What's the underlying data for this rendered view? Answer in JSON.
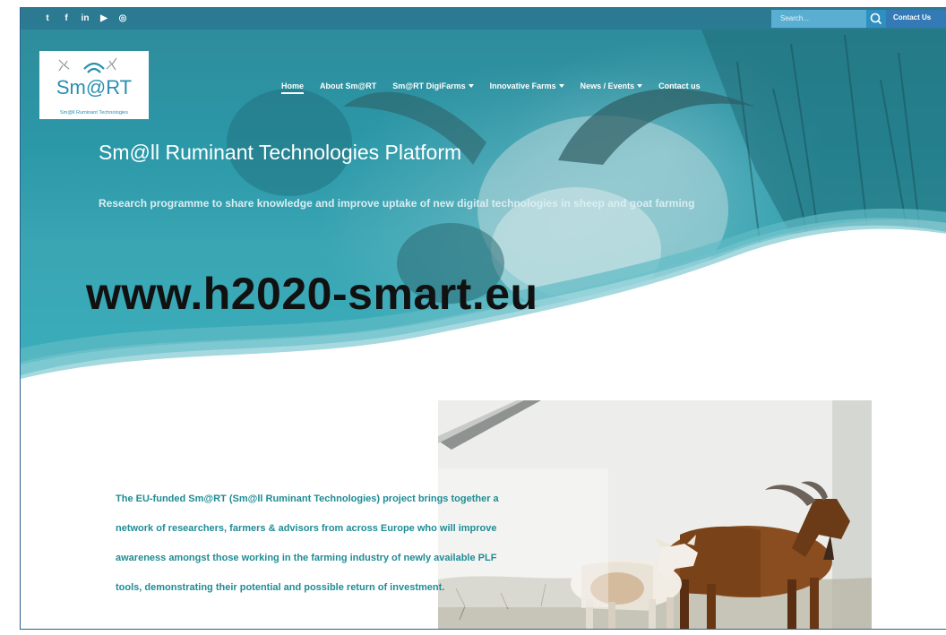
{
  "topbar": {
    "social_icons": [
      "twitter-icon",
      "facebook-icon",
      "linkedin-icon",
      "youtube-icon",
      "instagram-icon"
    ],
    "social_glyphs": [
      "t",
      "f",
      "in",
      "▶",
      "◎"
    ],
    "search": {
      "placeholder": "Search..."
    },
    "contact_label": "Contact Us"
  },
  "logo": {
    "main_text": "Sm@RT",
    "caption": "Sm@ll Ruminant Technologies"
  },
  "nav": {
    "items": [
      {
        "label": "Home",
        "active": true,
        "dropdown": false
      },
      {
        "label": "About Sm@RT",
        "active": false,
        "dropdown": false
      },
      {
        "label": "Sm@RT DigiFarms",
        "active": false,
        "dropdown": true
      },
      {
        "label": "Innovative Farms",
        "active": false,
        "dropdown": true
      },
      {
        "label": "News / Events",
        "active": false,
        "dropdown": true
      },
      {
        "label": "Contact us",
        "active": false,
        "dropdown": false
      }
    ]
  },
  "hero": {
    "title": "Sm@ll Ruminant Technologies Platform",
    "subtitle": "Research programme to share knowledge and improve uptake of new digital technologies in sheep and goat farming"
  },
  "overlay": {
    "url": "www.h2020-smart.eu"
  },
  "intro": {
    "lines": [
      "The EU-funded Sm@RT (Sm@ll Ruminant Technologies) project brings together a",
      "network of researchers, farmers & advisors from across Europe who will improve",
      "awareness amongst those working in the farming industry of newly available PLF",
      "tools, demonstrating their potential and possible return of investment."
    ]
  },
  "colors": {
    "hero_teal": "#2b98a8",
    "text_teal": "#1f8c95",
    "logo_blue": "#2a8fb0"
  }
}
